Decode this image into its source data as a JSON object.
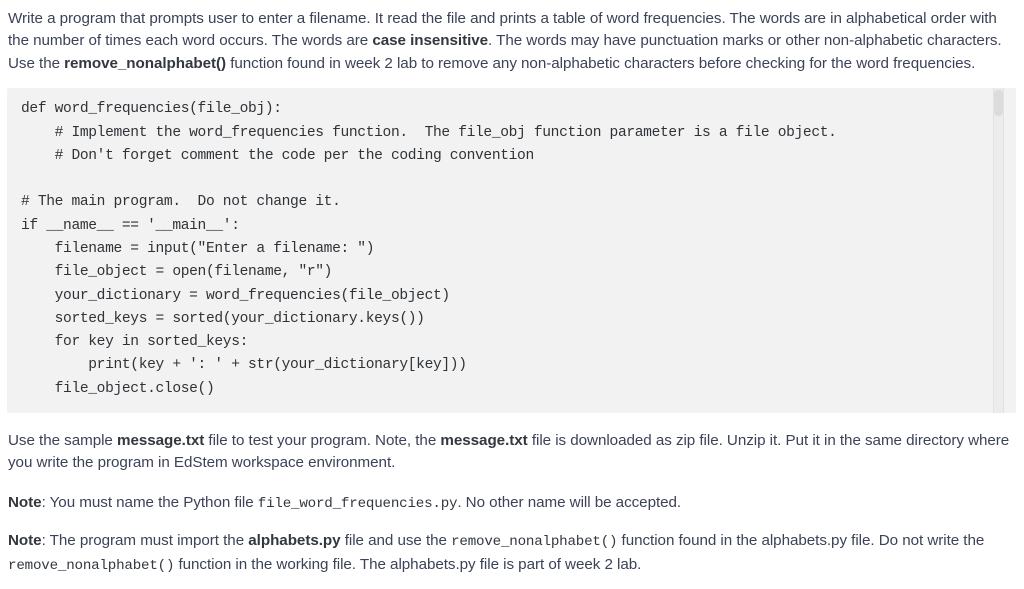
{
  "intro": {
    "seg1": "Write a program that prompts user to enter a filename. It read the file and prints a table of word frequencies. The words are in alphabetical order with the number of times each word occurs. The words are ",
    "bold1": "case insensitive",
    "seg2": ". The words may have punctuation marks or other non-alphabetic characters. Use the ",
    "bold2": "remove_nonalphabet()",
    "seg3": " function found in week 2 lab to remove any non-alphabetic characters before checking for the word frequencies."
  },
  "code_block": {
    "language": "python",
    "scrollbar_present": true,
    "content": "def word_frequencies(file_obj):\n    # Implement the word_frequencies function.  The file_obj function parameter is a file object.\n    # Don't forget comment the code per the coding convention\n\n# The main program.  Do not change it.\nif __name__ == '__main__':\n    filename = input(\"Enter a filename: \")\n    file_object = open(filename, \"r\")\n    your_dictionary = word_frequencies(file_object)\n    sorted_keys = sorted(your_dictionary.keys())\n    for key in sorted_keys:\n        print(key + ': ' + str(your_dictionary[key]))\n    file_object.close()"
  },
  "sample_para": {
    "seg1": "Use the sample ",
    "bold1": "message.txt",
    "seg2": " file to test your program. Note, the ",
    "bold2": "message.txt",
    "seg3": " file is downloaded as zip file. Unzip it. Put it in the same directory where you write the program in EdStem workspace environment."
  },
  "note_filename": {
    "label": "Note",
    "seg1": ": You must name the Python file ",
    "code1": "file_word_frequencies.py",
    "seg2": ". No other name will be accepted."
  },
  "note_import": {
    "label": "Note",
    "seg1": ": The program must import the ",
    "bold1": "alphabets.py",
    "seg2": " file and use the ",
    "code1": "remove_nonalphabet()",
    "seg3": " function found in the alphabets.py file. Do not write the ",
    "code2": "remove_nonalphabet()",
    "seg4": " function in the working file. The alphabets.py file is part of week 2 lab."
  },
  "colors": {
    "text": "#3c4257",
    "code_background": "#f2f2f2",
    "code_text": "#2f3337",
    "page_background": "#ffffff"
  }
}
